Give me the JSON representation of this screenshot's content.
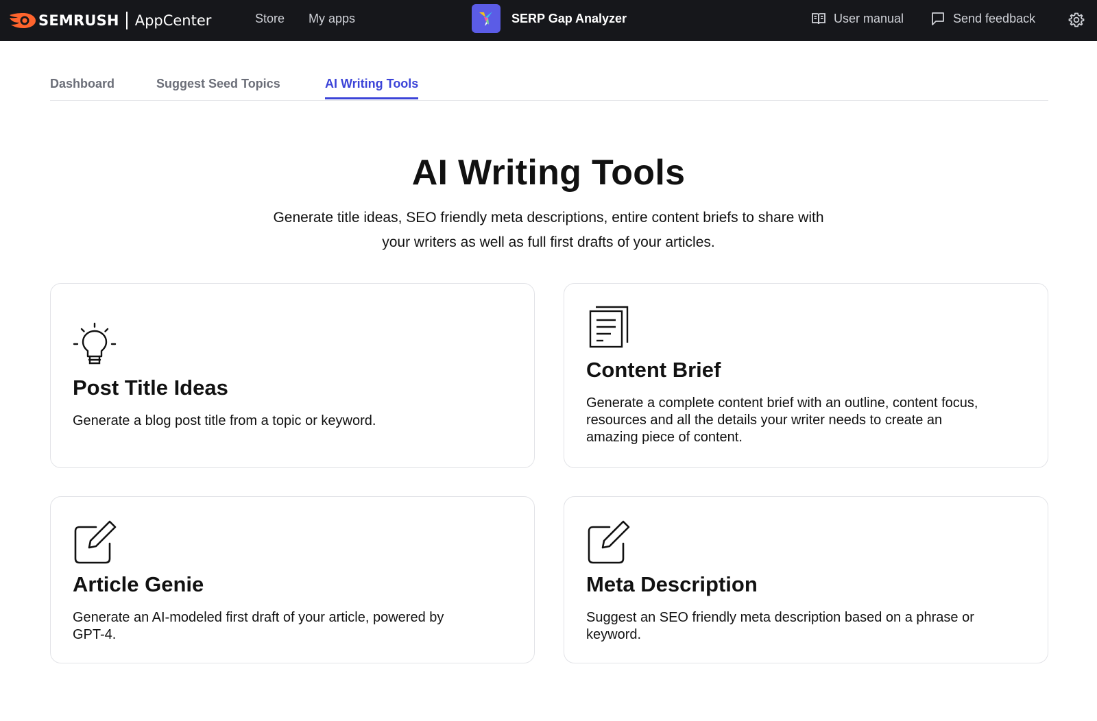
{
  "topbar": {
    "brand_name": "SEMRUSH",
    "brand_app": "AppCenter",
    "nav": [
      "Store",
      "My apps"
    ],
    "app_name": "SERP Gap Analyzer",
    "actions": {
      "user_manual": "User manual",
      "send_feedback": "Send feedback"
    },
    "colors": {
      "background": "#16171b",
      "brand_accent": "#ff642d",
      "app_logo_bg": "#5b5ce6"
    }
  },
  "tabs": [
    {
      "label": "Dashboard",
      "active": false
    },
    {
      "label": "Suggest Seed Topics",
      "active": false
    },
    {
      "label": "AI Writing Tools",
      "active": true
    }
  ],
  "tab_active_color": "#3b43d8",
  "hero": {
    "title": "AI Writing Tools",
    "subtitle": "Generate title ideas, SEO friendly meta descriptions, entire content briefs to share with your writers as well as full first drafts of your articles."
  },
  "cards": [
    {
      "icon": "lightbulb-icon",
      "title": "Post Title Ideas",
      "description": "Generate a blog post title from a topic or keyword."
    },
    {
      "icon": "document-stack-icon",
      "title": "Content Brief",
      "description": "Generate a complete content brief with an outline, content focus, resources and all the details your writer needs to create an amazing piece of content."
    },
    {
      "icon": "edit-pencil-icon",
      "title": "Article Genie",
      "description": "Generate an AI-modeled first draft of your article, powered by GPT-4."
    },
    {
      "icon": "edit-pencil-icon",
      "title": "Meta Description",
      "description": "Suggest an SEO friendly meta description based on a phrase or keyword."
    }
  ]
}
